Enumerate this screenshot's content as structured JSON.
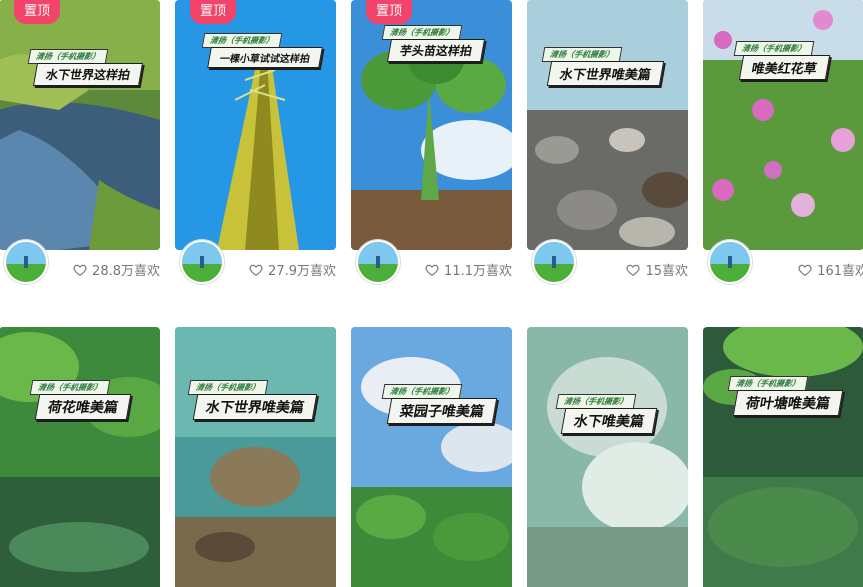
{
  "feed": {
    "row1": [
      {
        "pin": "置顶",
        "tag": "清扬（手机摄影）",
        "title": "水下世界这样拍",
        "likes": "28.8万喜欢"
      },
      {
        "pin": "置顶",
        "tag": "清扬（手机摄影）",
        "title": "一棵小草试试这样拍",
        "likes": "27.9万喜欢"
      },
      {
        "pin": "置顶",
        "tag": "清扬（手机摄影）",
        "title": "芋头苗这样拍",
        "likes": "11.1万喜欢"
      },
      {
        "pin": "",
        "tag": "清扬（手机摄影）",
        "title": "水下世界唯美篇",
        "likes": "15喜欢"
      },
      {
        "pin": "",
        "tag": "清扬（手机摄影）",
        "title": "唯美红花草",
        "likes": "161喜欢"
      }
    ],
    "row2": [
      {
        "tag": "清扬（手机摄影）",
        "title": "荷花唯美篇"
      },
      {
        "tag": "清扬（手机摄影）",
        "title": "水下世界唯美篇"
      },
      {
        "tag": "清扬（手机摄影）",
        "title": "菜园子唯美篇"
      },
      {
        "tag": "清扬（手机摄影）",
        "title": "水下唯美篇"
      },
      {
        "tag": "清扬（手机摄影）",
        "title": "荷叶塘唯美篇"
      }
    ]
  },
  "colors": {
    "pin": "#f2436b",
    "like_text": "#777777"
  },
  "icons": {
    "like": "heart-outline-icon",
    "avatar": "user-avatar"
  }
}
